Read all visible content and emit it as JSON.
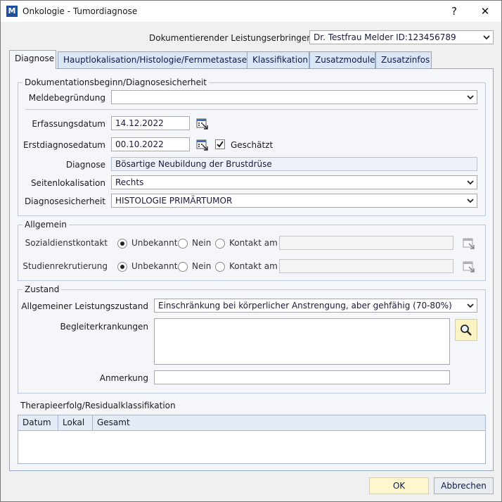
{
  "window": {
    "title": "Onkologie - Tumordiagnose",
    "icon_text": "M",
    "help": "?",
    "close": "✕"
  },
  "header": {
    "provider_label": "Dokumentierender Leistungserbringer",
    "provider_value": "Dr. Testfrau Melder ID:123456789"
  },
  "tabs": [
    {
      "label": "Diagnose"
    },
    {
      "label": "Hauptlokalisation/Histologie/Fernmetastasen"
    },
    {
      "label": "Klassifikation"
    },
    {
      "label": "Zusatzmodule"
    },
    {
      "label": "Zusatzinfos"
    }
  ],
  "doku": {
    "title": "Dokumentationsbeginn/Diagnosesicherheit",
    "meldebegruendung_label": "Meldebegründung",
    "meldebegruendung_value": "",
    "erfassungsdatum_label": "Erfassungsdatum",
    "erfassungsdatum_value": "14.12.2022",
    "erstdiagnosedatum_label": "Erstdiagnosedatum",
    "erstdiagnosedatum_value": "00.10.2022",
    "geschaetzt_label": "Geschätzt",
    "geschaetzt_checked": true,
    "diagnose_label": "Diagnose",
    "diagnose_value": "Bösartige Neubildung der Brustdrüse",
    "seitenlokalisation_label": "Seitenlokalisation",
    "seitenlokalisation_value": "Rechts",
    "diagnosesicherheit_label": "Diagnosesicherheit",
    "diagnosesicherheit_value": "HISTOLOGIE PRIMÄRTUMOR"
  },
  "allgemein": {
    "title": "Allgemein",
    "sozial_label": "Sozialdienstkontakt",
    "studien_label": "Studienrekrutierung",
    "opt_unbekannt": "Unbekannt",
    "opt_nein": "Nein",
    "opt_kontakt": "Kontakt am",
    "sozial_selected": "Unbekannt",
    "studien_selected": "Unbekannt"
  },
  "zustand": {
    "title": "Zustand",
    "leistung_label": "Allgemeiner Leistungszustand",
    "leistung_value": "Einschränkung bei körperlicher Anstrengung, aber gehfähig (70-80%)",
    "begleit_label": "Begleiterkrankungen",
    "anmerkung_label": "Anmerkung"
  },
  "therapie": {
    "title": "Therapieerfolg/Residualklassifikation",
    "columns": [
      "Datum",
      "Lokal",
      "Gesamt"
    ]
  },
  "buttons": {
    "ok": "OK",
    "cancel": "Abbrechen"
  },
  "colors": {
    "tab_bg": "#dbe6f5",
    "panel_bg": "#f4f6fa",
    "ok_bg": "#fdf6cf",
    "search_bg": "#fbf3c4"
  }
}
